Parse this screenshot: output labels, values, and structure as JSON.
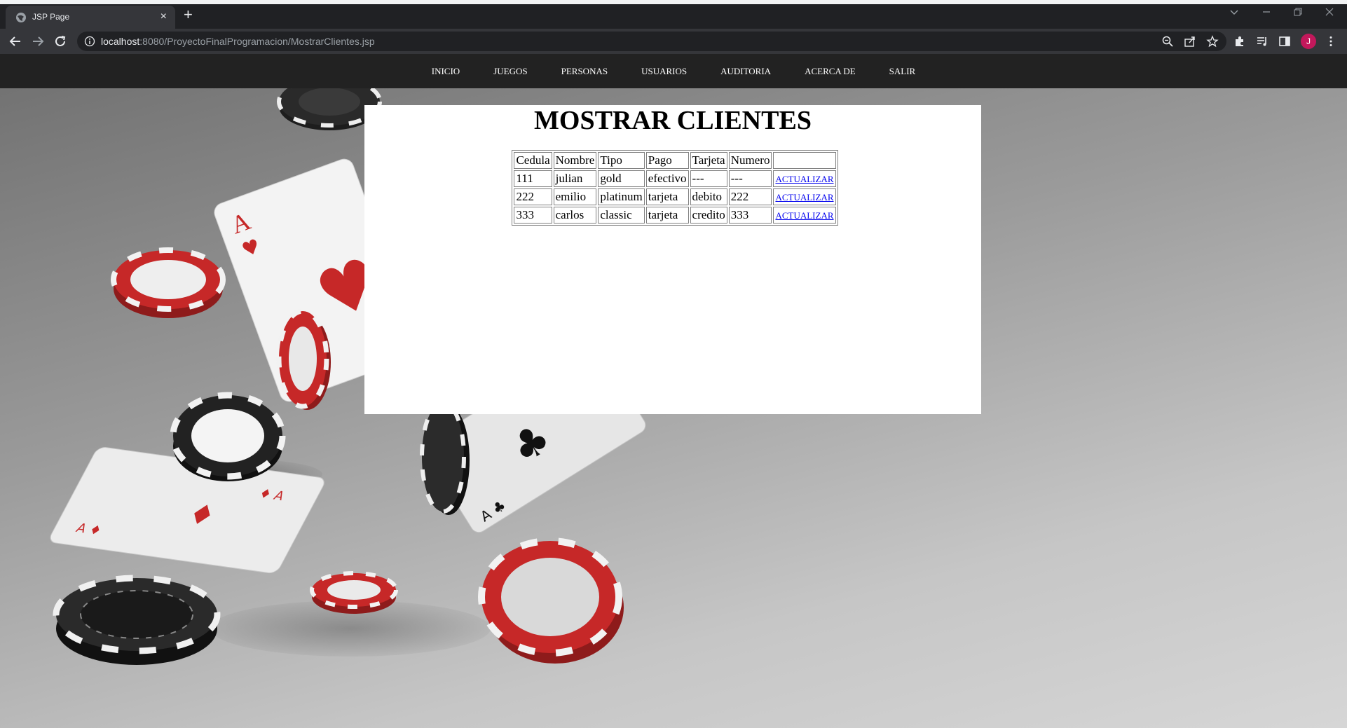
{
  "browser": {
    "tab_title": "JSP Page",
    "tab_close": "×",
    "new_tab": "+",
    "url_host": "localhost",
    "url_rest": ":8080/ProyectoFinalProgramacion/MostrarClientes.jsp",
    "profile_initial": "J"
  },
  "nav": {
    "items": [
      "INICIO",
      "JUEGOS",
      "PERSONAS",
      "USUARIOS",
      "AUDITORIA",
      "ACERCA DE",
      "SALIR"
    ]
  },
  "page": {
    "title": "MOSTRAR CLIENTES"
  },
  "table": {
    "headers": [
      "Cedula",
      "Nombre",
      "Tipo",
      "Pago",
      "Tarjeta",
      "Numero"
    ],
    "rows": [
      [
        "111",
        "julian",
        "gold",
        "efectivo",
        "---",
        "---"
      ],
      [
        "222",
        "emilio",
        "platinum",
        "tarjeta",
        "debito",
        "222"
      ],
      [
        "333",
        "carlos",
        "classic",
        "tarjeta",
        "credito",
        "333"
      ]
    ],
    "action_label": "ACTUALIZAR"
  },
  "colors": {
    "chrome_dark": "#202124",
    "chrome_toolbar": "#35363a",
    "nav_bg": "#222222",
    "link": "#0000ee",
    "chip_red": "#c62828",
    "chip_black": "#222222"
  }
}
